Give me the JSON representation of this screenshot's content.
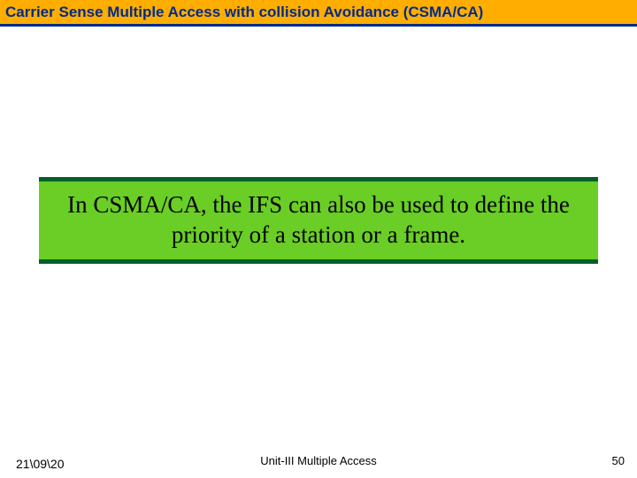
{
  "header": {
    "title": "Carrier Sense Multiple Access with collision Avoidance  (CSMA/CA)"
  },
  "callout": {
    "text": "In CSMA/CA, the IFS can also be used to define the priority of a station or a frame."
  },
  "footer": {
    "date": "21\\09\\20",
    "center": "Unit-III Multiple Access",
    "page": "50"
  }
}
